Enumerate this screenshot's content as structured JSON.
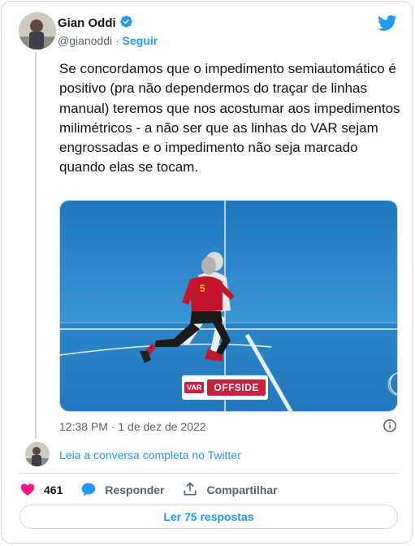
{
  "author": {
    "name": "Gian Oddi",
    "handle": "@gianoddi",
    "separator": "·",
    "follow_label": "Seguir",
    "verified": true
  },
  "tweet": {
    "text": "Se concordamos que o impedimento semiautomático é positivo (pra não dependermos do traçar de linhas manual) teremos que nos acostumar aos impedimentos milimétricos - a não ser que as linhas do VAR sejam engrossadas e o impedimento não seja marcado quando elas se tocam.",
    "timestamp": "12:38 PM · 1 de dez de 2022"
  },
  "media": {
    "badge_var": "VAR",
    "badge_label": "OFFSIDE"
  },
  "conversation": {
    "link_label": "Leia a conversa completa no Twitter"
  },
  "actions": {
    "like_count": "461",
    "reply_label": "Responder",
    "share_label": "Compartilhar"
  },
  "footer": {
    "read_replies_label": "Ler 75 respostas"
  },
  "colors": {
    "accent": "#1d9bf0",
    "like": "#f91880",
    "badge": "#cc1f3d",
    "pitch": "#2a86c9"
  }
}
